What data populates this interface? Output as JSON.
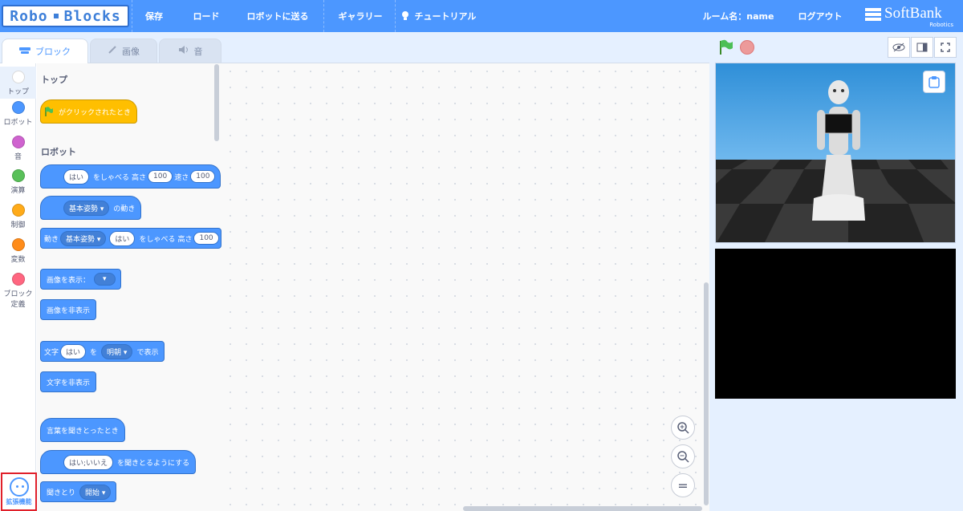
{
  "logo": {
    "left": "Robo",
    "right": "Blocks"
  },
  "menu": {
    "save": "保存",
    "load": "ロード",
    "send_to_robot": "ロボットに送る",
    "gallery": "ギャラリー",
    "tutorial": "チュートリアル",
    "room_name": "ルーム名：name",
    "logout": "ログアウト"
  },
  "brand": {
    "name": "SoftBank",
    "sub": "Robotics"
  },
  "tabs": {
    "blocks": "ブロック",
    "costumes": "画像",
    "sounds": "音"
  },
  "categories": [
    {
      "label": "トップ",
      "color": "#ffffff"
    },
    {
      "label": "ロボット",
      "color": "#4c97ff"
    },
    {
      "label": "音",
      "color": "#cf63cf"
    },
    {
      "label": "演算",
      "color": "#59c059"
    },
    {
      "label": "制御",
      "color": "#ffab19"
    },
    {
      "label": "変数",
      "color": "#ff8c1a"
    },
    {
      "label": "ブロック",
      "label2": "定義",
      "color": "#ff6680"
    }
  ],
  "extension_label": "拡張機能",
  "palette": {
    "top_title": "トップ",
    "robot_title": "ロボット",
    "when_flag": "がクリックされたとき",
    "say": {
      "value": "はい",
      "text": "をしゃべる",
      "pitch_label": "高さ",
      "pitch": "100",
      "speed_label": "速さ",
      "speed": "100"
    },
    "motion": {
      "pose": "基本姿勢",
      "text": "の動き"
    },
    "motion_say": {
      "prefix": "動き",
      "pose": "基本姿勢",
      "value": "はい",
      "text": "をしゃべる",
      "pitch_label": "高さ",
      "pitch": "100"
    },
    "show_image": {
      "text": "画像を表示："
    },
    "hide_image": "画像を非表示",
    "show_text": {
      "prefix": "文字",
      "value": "はい",
      "mid": "を",
      "font": "明朝",
      "suffix": "で表示"
    },
    "hide_text": "文字を非表示",
    "when_heard": "言葉を聞きとったとき",
    "listen": {
      "value": "はい;いいえ",
      "text": "を聞きとるようにする"
    },
    "listen_toggle": {
      "prefix": "聞きとり",
      "value": "開始"
    }
  },
  "zoom": {
    "in": "+",
    "out": "−",
    "reset": "="
  }
}
